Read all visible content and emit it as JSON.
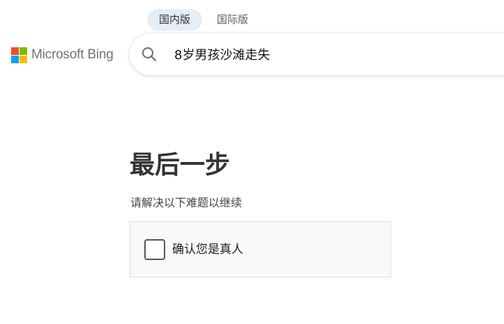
{
  "region_tabs": [
    {
      "label": "国内版",
      "active": true
    },
    {
      "label": "国际版",
      "active": false
    }
  ],
  "logo": {
    "text": "Microsoft Bing",
    "colors": [
      "#f25022",
      "#7fba00",
      "#00a4ef",
      "#ffb900"
    ]
  },
  "search": {
    "icon": "search-icon",
    "value": "8岁男孩沙滩走失"
  },
  "challenge": {
    "title": "最后一步",
    "subtitle": "请解决以下难题以继续",
    "checkbox_label": "确认您是真人",
    "checked": false
  }
}
